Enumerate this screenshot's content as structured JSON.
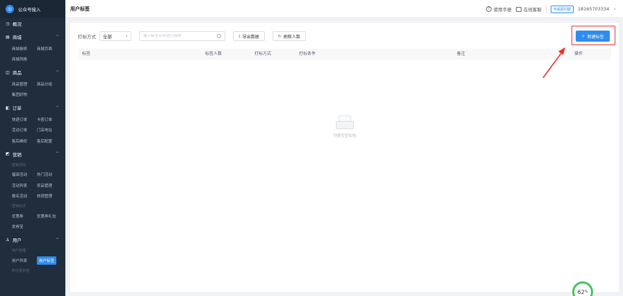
{
  "app": {
    "name": "公众号接入",
    "logo_glyph": "◎"
  },
  "sidebar": {
    "overview": "概况",
    "groups": [
      {
        "title": "商城",
        "rows": [
          [
            "商城装修",
            "商城页面"
          ],
          [
            "商城风格"
          ]
        ]
      },
      {
        "title": "商品",
        "rows": [
          [
            "商品管理",
            "商品分组"
          ],
          [
            "集团好物"
          ]
        ]
      },
      {
        "title": "订单",
        "rows": [
          [
            "快递订单",
            "卡密订单"
          ],
          [
            "活动订单",
            "门店地址"
          ],
          [
            "售后维权",
            "售后配置"
          ]
        ]
      },
      {
        "title": "营销",
        "head1": "营销活动",
        "rows1": [
          [
            "福袋活动",
            "热门活动"
          ],
          [
            "活动列表",
            "奖品管理"
          ],
          [
            "报名活动",
            "核销管理"
          ]
        ],
        "head2": "营销玩法",
        "rows2": [
          [
            "优惠券",
            "优惠券礼包"
          ],
          [
            "发券宝"
          ]
        ]
      },
      {
        "title": "用户",
        "head": "用户管理",
        "rows": [
          [
            "用户列表",
            "用户标签"
          ]
        ],
        "tail": "积分成长值"
      }
    ]
  },
  "header": {
    "title": "用户标签",
    "help": "使用手册",
    "service": "在线客服",
    "badge": "专属顾问服",
    "phone": "18165703334"
  },
  "toolbar": {
    "method_label": "打标方式",
    "method_value": "全部",
    "search_placeholder": "输入标签名称进行搜索",
    "export_label": "导出数据",
    "refresh_label": "刷新人数",
    "new_label": "新建标签"
  },
  "table": {
    "columns": [
      "标签",
      "标签人数",
      "打标方式",
      "打标条件",
      "备注",
      "操作"
    ],
    "empty_text": "列表空空如也"
  },
  "progress": {
    "value": 62,
    "unit": "%"
  },
  "colors": {
    "accent": "#2d8cf0",
    "sidebar": "#1f2d3d",
    "highlight": "#e8342c",
    "progress": "#46c35f"
  }
}
